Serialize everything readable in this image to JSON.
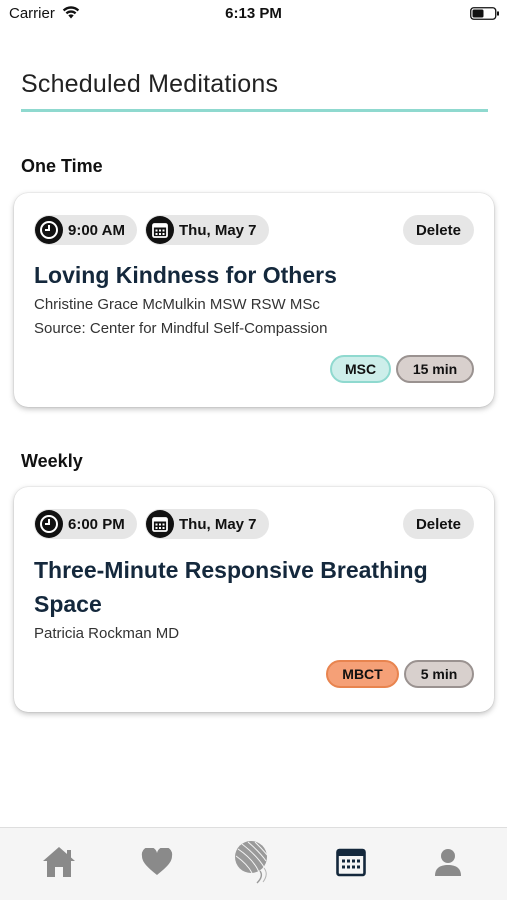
{
  "status_bar": {
    "carrier": "Carrier",
    "time": "6:13 PM"
  },
  "page": {
    "title": "Scheduled Meditations",
    "accent_color": "#8fd9cf"
  },
  "sections": [
    {
      "heading": "One Time",
      "card": {
        "time": "9:00 AM",
        "date": "Thu, May 7",
        "delete_label": "Delete",
        "title": "Loving Kindness for Others",
        "teacher": "Christine Grace McMulkin MSW RSW MSc",
        "source": "Source: Center for Mindful Self-Compassion",
        "program_tag": "MSC",
        "duration_tag": "15 min"
      }
    },
    {
      "heading": "Weekly",
      "card": {
        "time": "6:00 PM",
        "date": "Thu, May 7",
        "delete_label": "Delete",
        "title": "Three-Minute Responsive Breathing Space",
        "teacher": "Patricia Rockman MD",
        "program_tag": "MBCT",
        "duration_tag": "5 min"
      }
    }
  ],
  "tab_bar": {
    "items": [
      {
        "icon": "home-icon",
        "active": false
      },
      {
        "icon": "heart-icon",
        "active": false
      },
      {
        "icon": "yarn-ball-icon",
        "active": false
      },
      {
        "icon": "calendar-icon",
        "active": true
      },
      {
        "icon": "profile-icon",
        "active": false
      }
    ],
    "active_color": "#14283c",
    "inactive_color": "#8a8a8a"
  }
}
